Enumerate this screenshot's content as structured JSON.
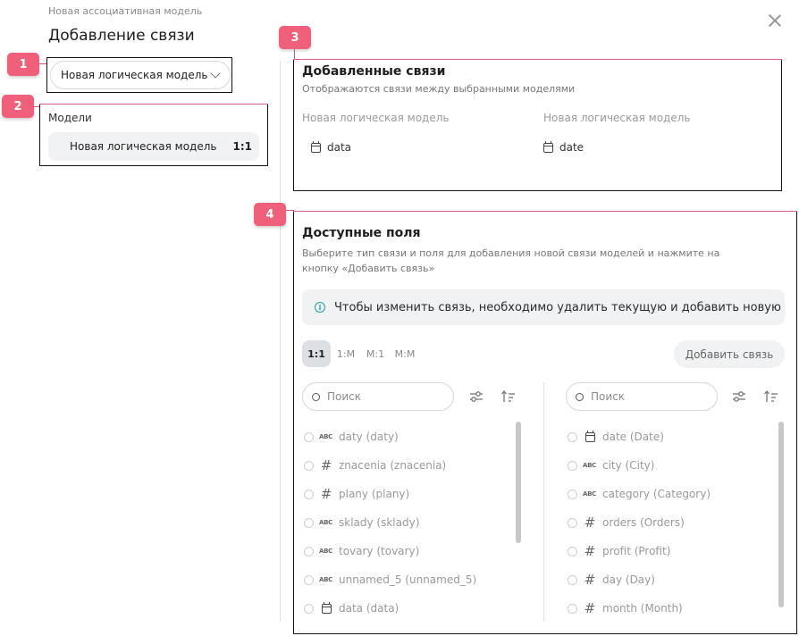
{
  "breadcrumb": "Новая ассоциативная модель",
  "dialog_title": "Добавление связи",
  "markers": [
    "1",
    "2",
    "3",
    "4"
  ],
  "model_select": {
    "value": "Новая логическая модель"
  },
  "models": {
    "label": "Модели",
    "items": [
      {
        "name": "Новая логическая модель",
        "relation": "1:1"
      }
    ]
  },
  "added_links": {
    "title": "Добавленные связи",
    "subtitle": "Отображаются связи между выбранными моделями",
    "left_model": "Новая логическая модель",
    "right_model": "Новая логическая модель",
    "left_field": {
      "name": "data",
      "icon": "calendar-icon"
    },
    "right_field": {
      "name": "date",
      "icon": "calendar-icon"
    }
  },
  "available_fields": {
    "title": "Доступные поля",
    "subtitle": "Выберите тип связи и поля для добавления новой связи моделей и нажмите на кнопку «Добавить связь»",
    "info": "Чтобы изменить связь, необходимо удалить текущую и добавить новую",
    "relation_tabs": [
      "1:1",
      "1:M",
      "M:1",
      "M:M"
    ],
    "active_tab": "1:1",
    "add_button": "Добавить связь",
    "search_placeholder": "Поиск",
    "left_fields": [
      {
        "type": "abc",
        "label": "daty (daty)"
      },
      {
        "type": "num",
        "label": "znacenia (znacenia)"
      },
      {
        "type": "num",
        "label": "plany (plany)"
      },
      {
        "type": "abc",
        "label": "sklady (sklady)"
      },
      {
        "type": "abc",
        "label": "tovary (tovary)"
      },
      {
        "type": "abc",
        "label": "unnamed_5 (unnamed_5)"
      },
      {
        "type": "date",
        "label": "data (data)"
      }
    ],
    "right_fields": [
      {
        "type": "date",
        "label": "date (Date)"
      },
      {
        "type": "abc",
        "label": "city (City)"
      },
      {
        "type": "abc",
        "label": "category (Category)"
      },
      {
        "type": "num",
        "label": "orders (Orders)"
      },
      {
        "type": "num",
        "label": "profit (Profit)"
      },
      {
        "type": "num",
        "label": "day (Day)"
      },
      {
        "type": "num",
        "label": "month (Month)"
      }
    ],
    "type_glyphs": {
      "abc": "ABC",
      "num": "#"
    }
  },
  "colors": {
    "marker": "#f0607a",
    "accent_info": "#2aa0a0",
    "active_tab_bg": "#dcdfe3"
  }
}
